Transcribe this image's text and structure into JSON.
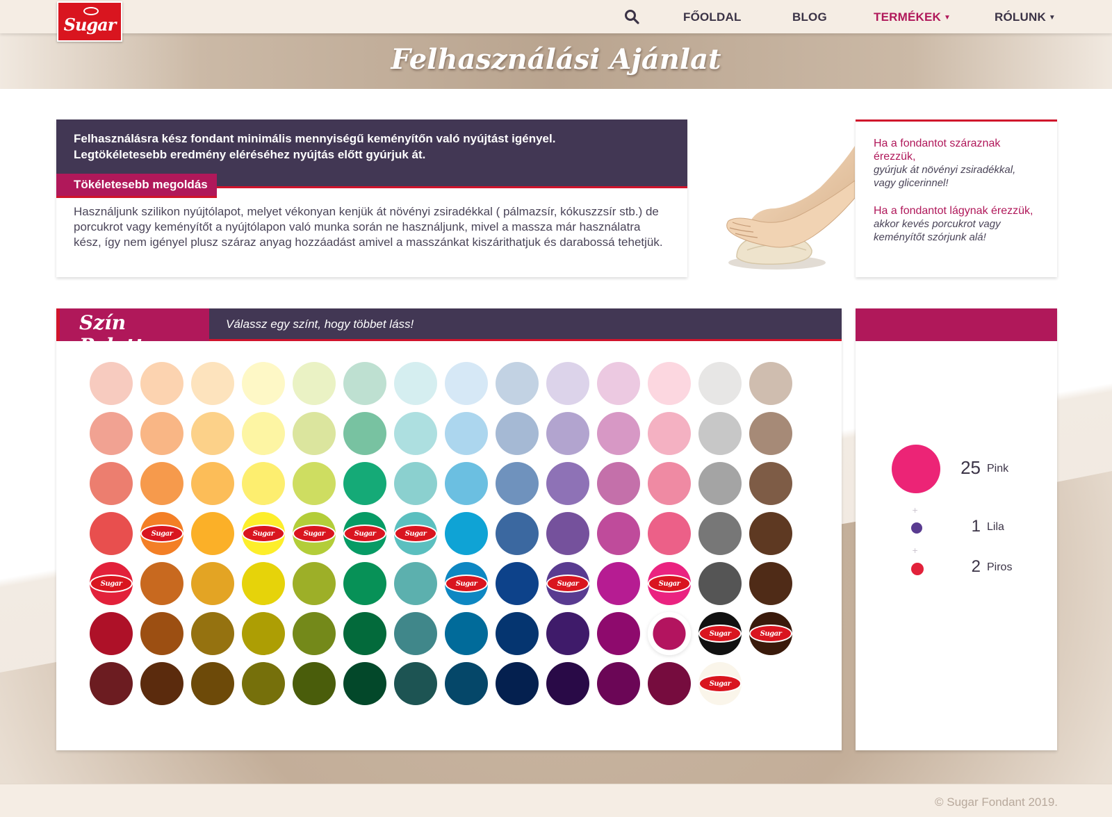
{
  "brand": {
    "logo_text": "Sugar",
    "brand_color": "#d9151f",
    "accent_color": "#b0185a",
    "dark_color": "#423754"
  },
  "nav": {
    "items": [
      {
        "label": "FŐOLDAL",
        "active": false,
        "dropdown": false
      },
      {
        "label": "BLOG",
        "active": false,
        "dropdown": false
      },
      {
        "label": "TERMÉKEK",
        "active": true,
        "dropdown": true
      },
      {
        "label": "RÓLUNK",
        "active": false,
        "dropdown": true
      }
    ],
    "search_icon": "search-icon"
  },
  "banner": {
    "title": "Felhasználási Ajánlat"
  },
  "info": {
    "intro_line1": "Felhasználásra kész fondant minimális mennyiségű keményítőn való nyújtást igényel.",
    "intro_line2": "Legtökéletesebb eredmény eléréséhez nyújtás előtt gyúrjuk át.",
    "subheading": "Tökéletesebb megoldás",
    "body": "Használjunk szilikon nyújtólapot, melyet vékonyan kenjük át növényi zsiradékkal ( pálmazsír, kókuszzsír stb.) de porcukrot vagy keményítőt a nyújtólapon való munka során ne használjunk, mivel a massza már használatra kész, így nem igényel plusz száraz anyag hozzáadást amivel a masszánkat kiszárithatjuk és darabossá tehetjük."
  },
  "tips": [
    {
      "title": "Ha a fondantot száraznak érezzük,",
      "text": "gyúrjuk át növényi zsiradékkal, vagy glicerinnel!"
    },
    {
      "title": "Ha a fondantot lágynak érezzük,",
      "text": "akkor kevés porcukrot vagy keményítőt szórjunk alá!"
    }
  ],
  "palette": {
    "title": "Szín Paletta",
    "subtitle": "Válassz egy színt, hogy többet láss!",
    "rows": [
      [
        {
          "c": "#f7cbbf"
        },
        {
          "c": "#fcd3b0"
        },
        {
          "c": "#fde3bd"
        },
        {
          "c": "#fef8c6"
        },
        {
          "c": "#eaf2c4"
        },
        {
          "c": "#bee0d1"
        },
        {
          "c": "#d5eef0"
        },
        {
          "c": "#d6e8f6"
        },
        {
          "c": "#c2d2e3"
        },
        {
          "c": "#dcd3ea"
        },
        {
          "c": "#ecc9e1"
        },
        {
          "c": "#fcd7e0"
        },
        {
          "c": "#e7e6e5"
        },
        {
          "c": "#cfbdaf"
        }
      ],
      [
        {
          "c": "#f1a292"
        },
        {
          "c": "#f9b685"
        },
        {
          "c": "#fcd189"
        },
        {
          "c": "#fdf5a3"
        },
        {
          "c": "#dbe59e"
        },
        {
          "c": "#78c2a1"
        },
        {
          "c": "#addfe0"
        },
        {
          "c": "#acd6ee"
        },
        {
          "c": "#a5b9d4"
        },
        {
          "c": "#b2a4cf"
        },
        {
          "c": "#d798c5"
        },
        {
          "c": "#f4b1c2"
        },
        {
          "c": "#c7c7c7"
        },
        {
          "c": "#a68a77"
        }
      ],
      [
        {
          "c": "#ec7e6f"
        },
        {
          "c": "#f69a4c"
        },
        {
          "c": "#fcbd58"
        },
        {
          "c": "#fdee6f"
        },
        {
          "c": "#cedd61"
        },
        {
          "c": "#15aa77"
        },
        {
          "c": "#8bd0cf"
        },
        {
          "c": "#6bbfe1"
        },
        {
          "c": "#6f92bd"
        },
        {
          "c": "#8e72b6"
        },
        {
          "c": "#c470aa"
        },
        {
          "c": "#ef8aa3"
        },
        {
          "c": "#a4a4a4"
        },
        {
          "c": "#7e5c46"
        }
      ],
      [
        {
          "c": "#e84f4e"
        },
        {
          "c": "#f37f26",
          "logo": true
        },
        {
          "c": "#fbb028"
        },
        {
          "c": "#fdee2b",
          "logo": true
        },
        {
          "c": "#b3cd39",
          "logo": true
        },
        {
          "c": "#079b65",
          "logo": true
        },
        {
          "c": "#5bbfbf",
          "logo": true
        },
        {
          "c": "#0fa3d5"
        },
        {
          "c": "#3b68a0"
        },
        {
          "c": "#75519c"
        },
        {
          "c": "#bf4b9b"
        },
        {
          "c": "#ec6088"
        },
        {
          "c": "#777777"
        },
        {
          "c": "#5e3922"
        }
      ],
      [
        {
          "c": "#e2213a",
          "logo": true
        },
        {
          "c": "#c8691f"
        },
        {
          "c": "#e3a424"
        },
        {
          "c": "#e6d30a"
        },
        {
          "c": "#9daf28"
        },
        {
          "c": "#079157"
        },
        {
          "c": "#5cb0ae"
        },
        {
          "c": "#0e87c2",
          "logo": true
        },
        {
          "c": "#0d428a"
        },
        {
          "c": "#593b90",
          "logo": true
        },
        {
          "c": "#b61c92"
        },
        {
          "c": "#ea2380",
          "logo": true
        },
        {
          "c": "#555555"
        },
        {
          "c": "#4f2b17"
        }
      ],
      [
        {
          "c": "#ae1128"
        },
        {
          "c": "#9c4f12"
        },
        {
          "c": "#957210"
        },
        {
          "c": "#ad9e04"
        },
        {
          "c": "#74891a"
        },
        {
          "c": "#036a3b"
        },
        {
          "c": "#40878a"
        },
        {
          "c": "#016b9a"
        },
        {
          "c": "#053570"
        },
        {
          "c": "#3f1b6a"
        },
        {
          "c": "#8e0a6d"
        },
        {
          "c": "#b3145f",
          "selected": true
        },
        {
          "c": "#111111",
          "logo": true
        },
        {
          "c": "#3a1a0b",
          "logo": true
        }
      ],
      [
        {
          "c": "#6c1c21"
        },
        {
          "c": "#5b2b0d"
        },
        {
          "c": "#6d4a09"
        },
        {
          "c": "#76700b"
        },
        {
          "c": "#4a5d0b"
        },
        {
          "c": "#03482a"
        },
        {
          "c": "#1d5453"
        },
        {
          "c": "#054769"
        },
        {
          "c": "#04204f"
        },
        {
          "c": "#290a47"
        },
        {
          "c": "#6b0656"
        },
        {
          "c": "#760c3e"
        },
        {
          "c": "#faf5ea",
          "logo": true
        }
      ]
    ]
  },
  "mix": {
    "items": [
      {
        "count": "25",
        "name": "Pink",
        "color": "#ec2476"
      },
      {
        "count": "1",
        "name": "Lila",
        "color": "#593b90"
      },
      {
        "count": "2",
        "name": "Piros",
        "color": "#e2213a"
      }
    ],
    "plus": "+"
  },
  "footer": {
    "copyright": "© Sugar Fondant 2019."
  }
}
